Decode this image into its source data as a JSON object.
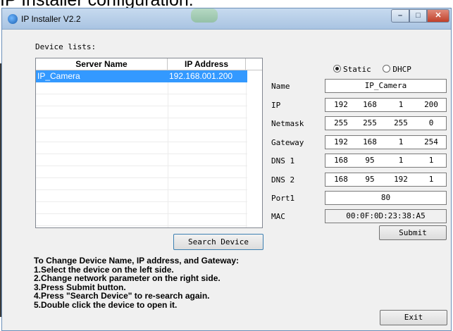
{
  "doc_heading": "IP Installer configuration:",
  "window": {
    "title": "IP Installer V2.2"
  },
  "device_lists_label": "Device lists:",
  "list": {
    "columns": [
      "Server Name",
      "IP Address"
    ],
    "rows": [
      {
        "name": "IP_Camera",
        "ip": "192.168.001.200"
      }
    ]
  },
  "search_button": "Search Device",
  "mode": {
    "static": "Static",
    "dhcp": "DHCP",
    "selected": "static"
  },
  "fields": {
    "name": {
      "label": "Name",
      "value": "IP_Camera"
    },
    "ip": {
      "label": "IP",
      "octets": [
        "192",
        "168",
        "1",
        "200"
      ]
    },
    "netmask": {
      "label": "Netmask",
      "octets": [
        "255",
        "255",
        "255",
        "0"
      ]
    },
    "gateway": {
      "label": "Gateway",
      "octets": [
        "192",
        "168",
        "1",
        "254"
      ]
    },
    "dns1": {
      "label": "DNS 1",
      "octets": [
        "168",
        "95",
        "1",
        "1"
      ]
    },
    "dns2": {
      "label": "DNS 2",
      "octets": [
        "168",
        "95",
        "192",
        "1"
      ]
    },
    "port1": {
      "label": "Port1",
      "value": "80"
    },
    "mac": {
      "label": "MAC",
      "value": "00:0F:0D:23:38:A5"
    }
  },
  "submit_button": "Submit",
  "exit_button": "Exit",
  "instructions": [
    "To Change Device Name, IP address, and Gateway:",
    "1.Select the device on the left side.",
    "2.Change network parameter on the right side.",
    "3.Press Submit button.",
    "4.Press  \"Search Device\"  to re-search again.",
    "5.Double click the device to open it."
  ]
}
